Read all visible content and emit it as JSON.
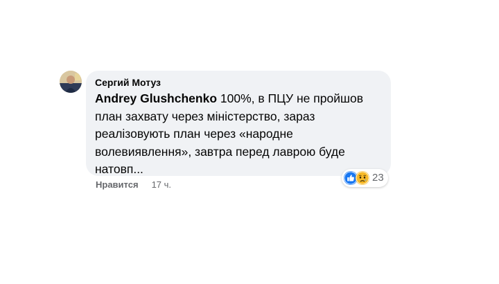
{
  "comment": {
    "author_name": "Сергий Мотуз",
    "mention": "Andrey Glushchenko",
    "body": " 100%, в ПЦУ не пройшов план захвату через міністерство, зараз реалізовують план через «народне волевиявлення», завтра перед лаврою буде натовп..."
  },
  "reactions": {
    "icons": [
      "like-icon",
      "sad-icon"
    ],
    "count": "23"
  },
  "actions": {
    "like_label": "Нравится",
    "timestamp": "17 ч."
  },
  "colors": {
    "bubble": "#f0f2f5",
    "text": "#050505",
    "secondary": "#65676b",
    "like_blue": "#1877f2",
    "sad_yellow": "#f7b928"
  }
}
